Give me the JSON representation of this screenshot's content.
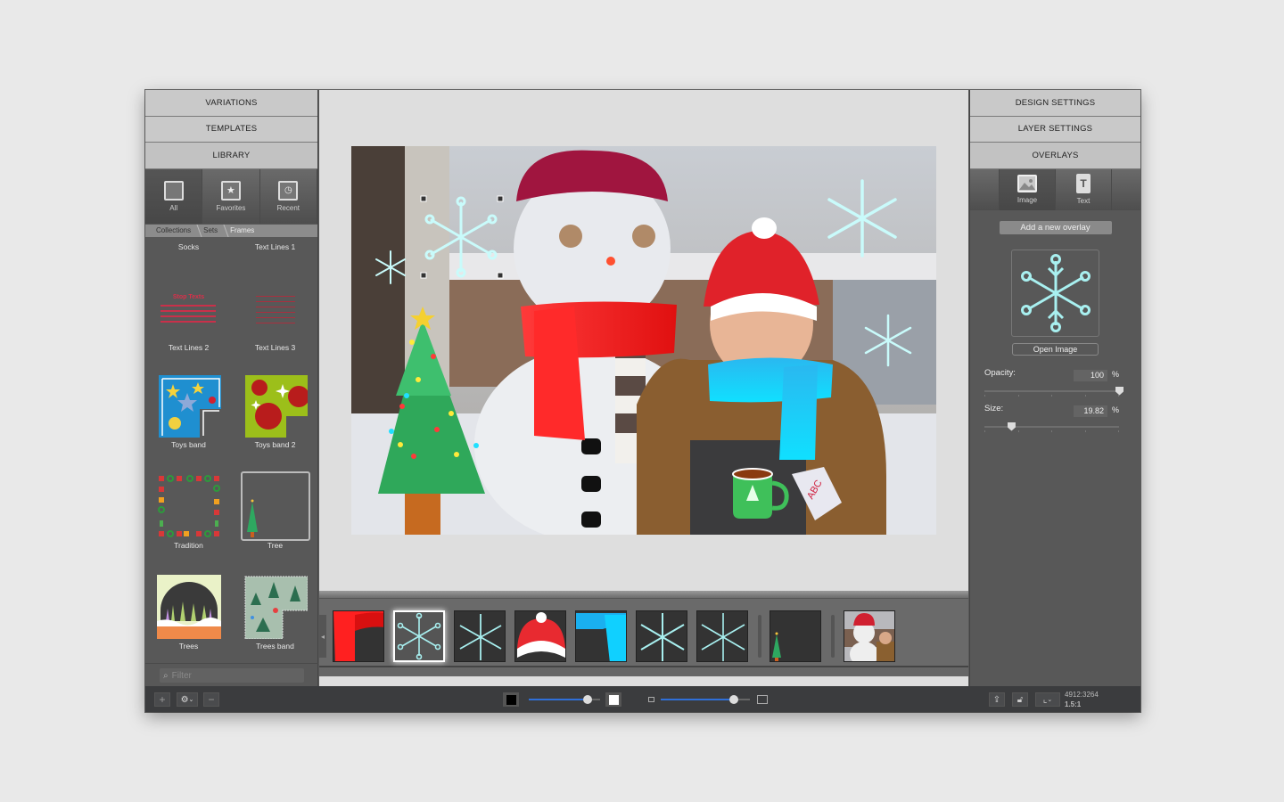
{
  "left_panel": {
    "sections": [
      {
        "label": "VARIATIONS"
      },
      {
        "label": "TEMPLATES"
      },
      {
        "label": "LIBRARY"
      }
    ],
    "library_tabs": [
      {
        "label": "All",
        "icon": "square-icon",
        "selected": true
      },
      {
        "label": "Favorites",
        "icon": "star-icon",
        "selected": false
      },
      {
        "label": "Recent",
        "icon": "clock-icon",
        "selected": false
      }
    ],
    "breadcrumb": [
      "Collections",
      "Sets",
      "Frames"
    ],
    "items": [
      {
        "label": "Socks"
      },
      {
        "label": "Text Lines 1"
      },
      {
        "label": "Text Lines 2"
      },
      {
        "label": "Text Lines 3"
      },
      {
        "label": "Toys band"
      },
      {
        "label": "Toys band 2"
      },
      {
        "label": "Tradition"
      },
      {
        "label": "Tree",
        "selected": true
      },
      {
        "label": "Trees"
      },
      {
        "label": "Trees band"
      }
    ],
    "text_lines_2_caption": "Stop Texts",
    "filter_placeholder": "Filter"
  },
  "right_panel": {
    "sections": [
      {
        "label": "DESIGN SETTINGS"
      },
      {
        "label": "LAYER SETTINGS"
      },
      {
        "label": "OVERLAYS"
      }
    ],
    "overlay_tabs": [
      {
        "label": "Image",
        "icon": "image-icon",
        "selected": true
      },
      {
        "label": "Text",
        "icon": "text-file-icon",
        "selected": false
      }
    ],
    "add_overlay_label": "Add a new overlay",
    "open_image_label": "Open Image",
    "opacity": {
      "label": "Opacity:",
      "value": "100",
      "unit": "%",
      "fraction": 1.0
    },
    "size": {
      "label": "Size:",
      "value": "19.82",
      "unit": "%",
      "fraction": 0.1982
    }
  },
  "canvas": {
    "overlays": [
      "snowflake",
      "snowflake",
      "snowflake",
      "snowflake",
      "santa-hat",
      "red-scarf",
      "blue-scarf",
      "christmas-tree",
      "green-mug"
    ],
    "mug_text": "ABC"
  },
  "filmstrip": {
    "items": [
      {
        "name": "red-scarf"
      },
      {
        "name": "snowflake-round",
        "selected": true
      },
      {
        "name": "snowflake"
      },
      {
        "name": "santa-hat"
      },
      {
        "name": "blue-scarf"
      },
      {
        "name": "snowflake-2"
      },
      {
        "name": "snowflake-3"
      },
      {
        "name": "tree-frame"
      },
      {
        "name": "photo"
      }
    ]
  },
  "bottom_bar": {
    "add_label": "+",
    "remove_label": "−",
    "background_slider_fraction": 0.82,
    "zoom_slider_fraction": 0.82,
    "dimensions": "4912:3264",
    "ratio": "1.5:1"
  },
  "colors": {
    "accent": "#2f6fd8",
    "snowflake": "#bff5f5",
    "panel": "#585858"
  }
}
